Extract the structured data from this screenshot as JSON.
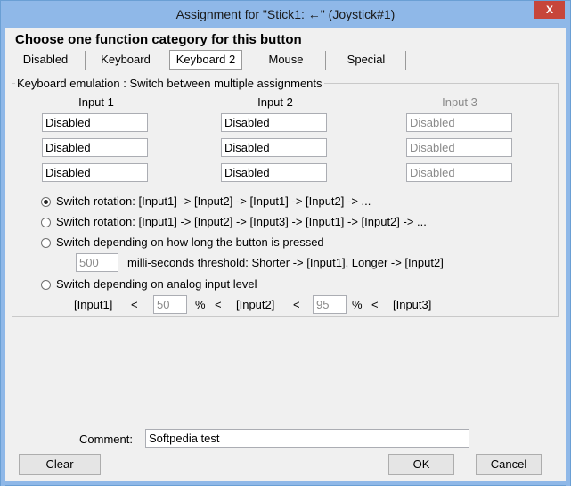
{
  "window": {
    "title": "Assignment for \"Stick1: ←\" (Joystick#1)",
    "close_glyph": "X"
  },
  "heading": "Choose one function category for this button",
  "tabs": [
    {
      "label": "Disabled"
    },
    {
      "label": "Keyboard"
    },
    {
      "label": "Keyboard 2",
      "active": true
    },
    {
      "label": "Mouse"
    },
    {
      "label": "Special"
    }
  ],
  "group": {
    "title": "Keyboard emulation : Switch between multiple assignments",
    "columns": [
      "Input 1",
      "Input 2",
      "Input 3"
    ],
    "input1": [
      "Disabled",
      "Disabled",
      "Disabled"
    ],
    "input2": [
      "Disabled",
      "Disabled",
      "Disabled"
    ],
    "input3": [
      "Disabled",
      "Disabled",
      "Disabled"
    ]
  },
  "options": {
    "opt1": "Switch rotation: [Input1] -> [Input2] -> [Input1] -> [Input2] -> ...",
    "opt2": "Switch rotation: [Input1] -> [Input2] -> [Input3] -> [Input1] -> [Input2] -> ...",
    "opt3": "Switch depending on how long the button is pressed",
    "opt4": "Switch depending on analog input level",
    "selected": "opt1"
  },
  "threshold": {
    "value": "500",
    "text": "milli-seconds threshold: Shorter -> [Input1], Longer -> [Input2]"
  },
  "analog": {
    "input1": "[Input1]",
    "lt1": "<",
    "val1": "50",
    "pct1": "%",
    "lt2": "<",
    "input2": "[Input2]",
    "lt3": "<",
    "val2": "95",
    "pct2": "%",
    "lt4": "<",
    "input3": "[Input3]"
  },
  "comment": {
    "label": "Comment:",
    "value": "Softpedia test"
  },
  "buttons": {
    "clear": "Clear",
    "ok": "OK",
    "cancel": "Cancel"
  }
}
